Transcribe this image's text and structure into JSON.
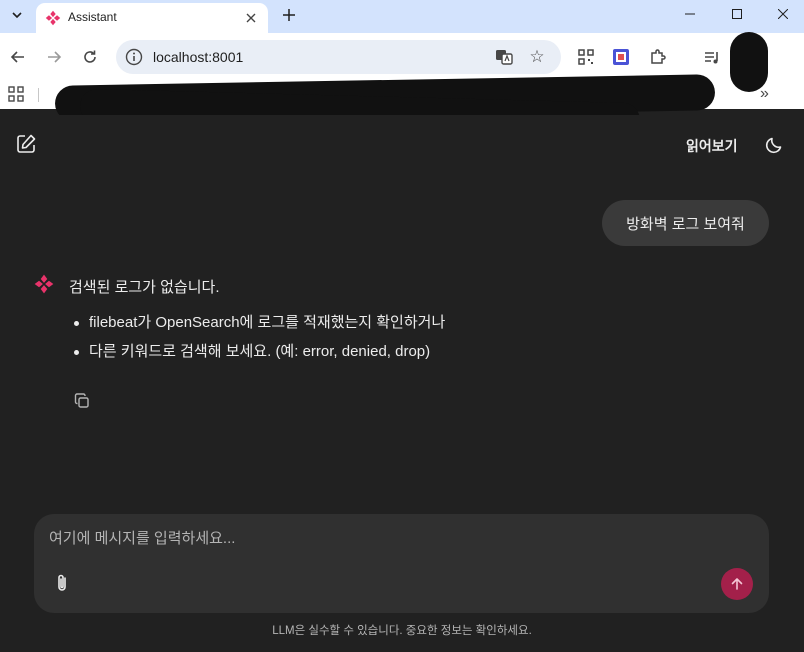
{
  "browser": {
    "tab_title": "Assistant",
    "url": "localhost:8001"
  },
  "app": {
    "header": {
      "read_label": "읽어보기"
    },
    "user_message": "방화벽 로그 보여줘",
    "assistant": {
      "text": "검색된 로그가 없습니다.",
      "bullets": [
        "filebeat가 OpenSearch에 로그를 적재했는지 확인하거나",
        "다른 키워드로 검색해 보세요. (예: error, denied, drop)"
      ]
    },
    "composer": {
      "placeholder": "여기에 메시지를 입력하세요..."
    },
    "disclaimer": "LLM은 실수할 수 있습니다. 중요한 정보는 확인하세요."
  },
  "colors": {
    "background": "#212121",
    "bubble": "#3a3a3a",
    "composer": "#303030",
    "accent": "#a3204a",
    "logo": "#e8336a"
  }
}
